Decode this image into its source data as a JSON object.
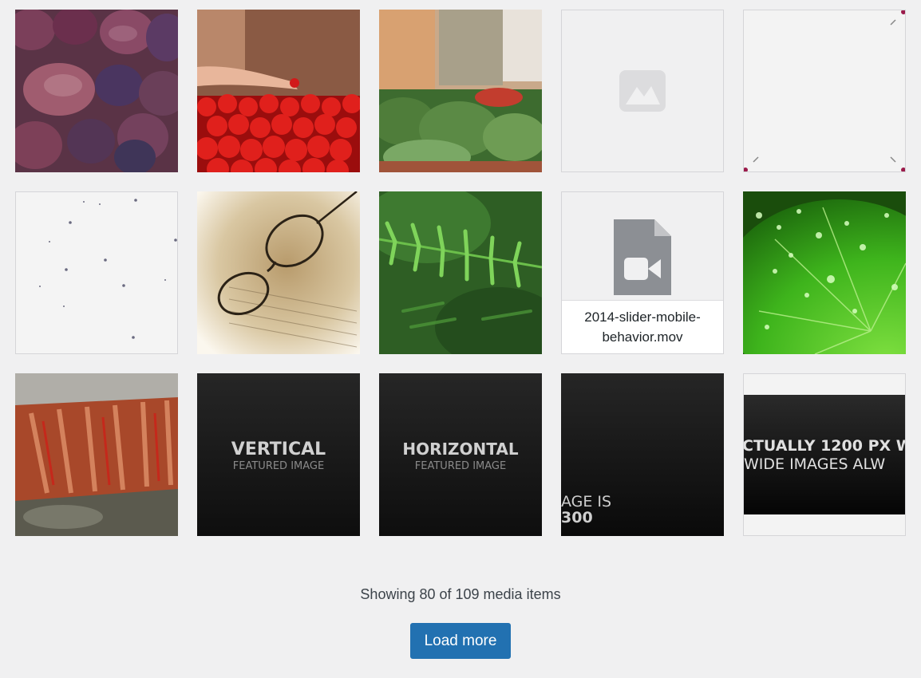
{
  "media": {
    "items": [
      {
        "name": "figs-thumbnail"
      },
      {
        "name": "tomatoes-thumbnail"
      },
      {
        "name": "market-greens-thumbnail"
      },
      {
        "name": "image-placeholder-thumbnail"
      },
      {
        "name": "blank-frame-thumbnail"
      },
      {
        "name": "dotted-paper-thumbnail"
      },
      {
        "name": "glasses-thumbnail"
      },
      {
        "name": "fern-thumbnail"
      },
      {
        "name": "video-file-thumbnail",
        "filename": "2014-slider-mobile-behavior.mov"
      },
      {
        "name": "leaf-droplets-thumbnail"
      },
      {
        "name": "bark-thumbnail"
      },
      {
        "name": "vertical-featured-thumbnail",
        "title": "VERTICAL",
        "subtitle": "FEATURED IMAGE"
      },
      {
        "name": "horizontal-featured-thumbnail",
        "title": "HORIZONTAL",
        "subtitle": "FEATURED IMAGE"
      },
      {
        "name": "image-is-thumbnail",
        "line1": "AGE IS",
        "line2": "300"
      },
      {
        "name": "wide-image-thumbnail",
        "line1": "CTUALLY 1200 PX W",
        "line2": "WIDE IMAGES ALW"
      }
    ]
  },
  "footer": {
    "status_text": "Showing 80 of 109 media items",
    "load_more_label": "Load more"
  },
  "colors": {
    "background": "#f0f0f1",
    "button": "#2271b1",
    "placeholder_icon": "#dcdcde",
    "file_icon": "#8c8f94"
  }
}
